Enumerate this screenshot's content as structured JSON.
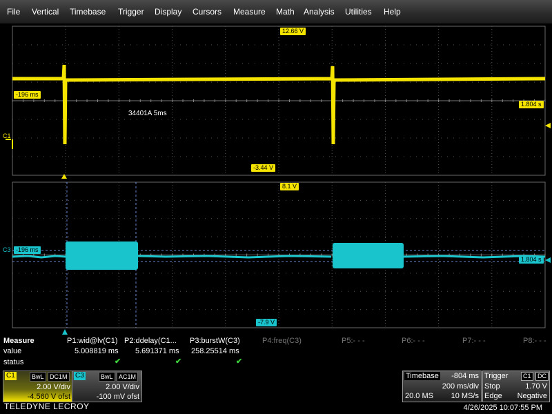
{
  "menu": [
    "File",
    "Vertical",
    "Timebase",
    "Trigger",
    "Display",
    "Cursors",
    "Measure",
    "Math",
    "Analysis",
    "Utilities",
    "Help"
  ],
  "top_panel": {
    "top_level_label": "12.66 V",
    "bottom_level_label": "-3.44 V",
    "left_time_label": "-196 ms",
    "right_time_label": "1.804 s",
    "annotation": "34401A 5ms",
    "channel_marker": "C1",
    "trace_color": "#f5e400"
  },
  "bottom_panel": {
    "top_level_label": "8.1 V",
    "bottom_level_label": "-7.9 V",
    "left_time_label": "-196 ms",
    "right_time_label": "1.804 s",
    "channel_marker": "C3",
    "trace_color": "#19c4cc"
  },
  "measure": {
    "title": "Measure",
    "row_labels": [
      "value",
      "status"
    ],
    "params": [
      {
        "name": "P1:wid@lv(C1)",
        "value": "5.008819 ms",
        "ok": true
      },
      {
        "name": "P2:ddelay(C1...",
        "value": "5.691371 ms",
        "ok": true
      },
      {
        "name": "P3:burstW(C3)",
        "value": "258.25514 ms",
        "ok": true
      },
      {
        "name": "P4:freq(C3)",
        "value": "",
        "ok": false
      },
      {
        "name": "P5:- - -",
        "value": "",
        "ok": false
      },
      {
        "name": "P6:- - -",
        "value": "",
        "ok": false
      },
      {
        "name": "P7:- - -",
        "value": "",
        "ok": false
      },
      {
        "name": "P8:- - -",
        "value": "",
        "ok": false
      }
    ],
    "check_glyph": "✔"
  },
  "channels": {
    "c1": {
      "tag": "C1",
      "bw": "BwL",
      "coupling": "DC1M",
      "vdiv": "2.00 V/div",
      "offset": "-4.560 V ofst",
      "color": "#f5e400"
    },
    "c3": {
      "tag": "C3",
      "bw": "BwL",
      "coupling": "AC1M",
      "vdiv": "2.00 V/div",
      "offset": "-100 mV ofst",
      "color": "#19c4cc"
    }
  },
  "timebase": {
    "label": "Timebase",
    "delay": "-804 ms",
    "tdiv": "200 ms/div",
    "samples": "20.0 MS",
    "rate": "10 MS/s"
  },
  "trigger": {
    "label": "Trigger",
    "source": "C1",
    "coupling": "DC",
    "mode": "Stop",
    "level": "1.70 V",
    "type": "Edge",
    "slope": "Negative"
  },
  "brand": "TELEDYNE LECROY",
  "datetime": "4/26/2025 10:07:55 PM"
}
